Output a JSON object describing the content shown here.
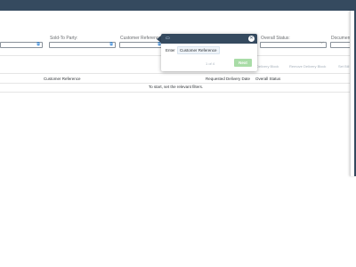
{
  "filters": {
    "sold_to_party_label": "Sold-To Party:",
    "customer_reference_label": "Customer Reference:",
    "overall_status_label": "Overall Status:",
    "document_label": "Document"
  },
  "toolbar": {
    "set_delivery_block": "Delivery Block",
    "remove_delivery_block": "Remove Delivery Block",
    "set_billing_block": "Set Bill"
  },
  "table": {
    "columns": {
      "customer_reference": "Customer Reference",
      "requested_delivery_date": "Requested Delivery Date",
      "overall_status": "Overall Status"
    },
    "empty_message": "To start, set the relevant filters."
  },
  "tour": {
    "enter_label": "Enter",
    "field_chip": "Customer Reference",
    "step_counter": "1 of 4",
    "next_button": "Next"
  },
  "colors": {
    "shell": "#354a5f",
    "accent": "#0a6ed1",
    "next_button": "#a9dca7"
  }
}
